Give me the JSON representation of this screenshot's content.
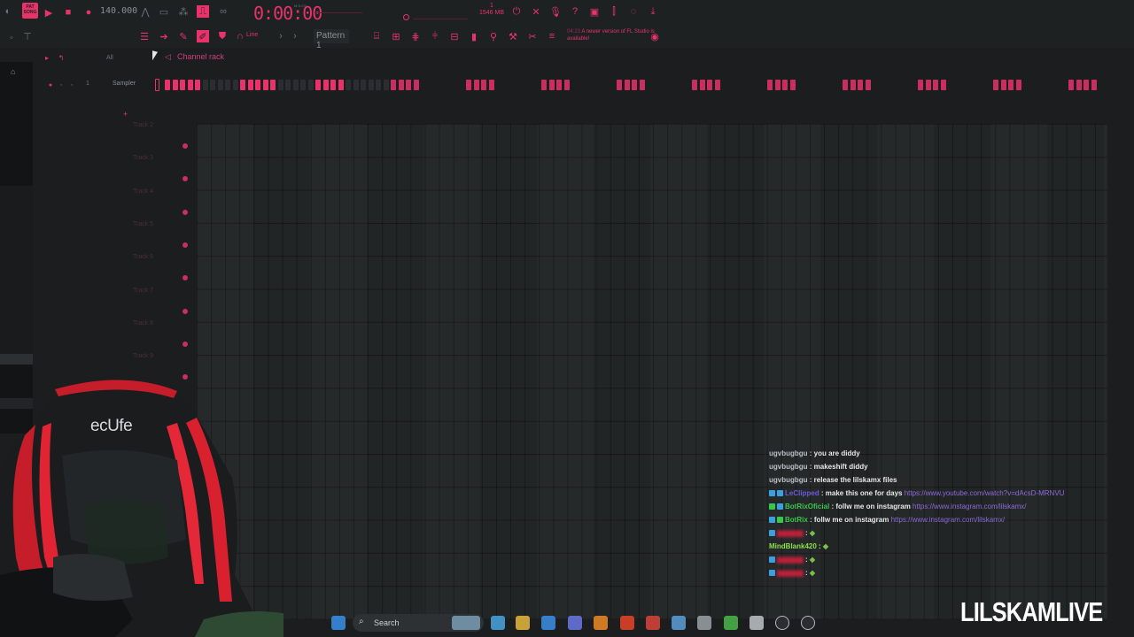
{
  "toolbar": {
    "menu_badge": "PAT SONG",
    "bpm": "140.000",
    "song_time": "0:00:00",
    "time_label": "M:S:CS",
    "cpu_ram": "1546 MB",
    "cpu_count": "1",
    "pattern": "Pattern 1",
    "snap": "Line",
    "news_time": "04:23",
    "news_text": "A newer version of FL Studio is available!"
  },
  "channel_rack": {
    "filter": "All",
    "title": "Channel rack",
    "channel_number": "1",
    "channel_name": "Sampler",
    "steps": [
      1,
      1,
      1,
      1,
      1,
      0,
      0,
      0,
      0,
      0,
      1,
      1,
      1,
      1,
      1,
      0,
      0,
      0,
      0,
      0,
      1,
      1,
      1,
      1,
      0,
      0,
      0,
      0,
      0,
      0,
      1,
      1,
      1,
      1,
      0,
      0,
      0,
      0,
      0,
      0,
      1,
      1,
      1,
      1,
      0,
      0,
      0,
      0,
      0,
      0,
      1,
      1,
      1,
      1,
      0,
      0,
      0,
      0,
      0,
      0,
      1,
      1,
      1,
      1,
      0,
      0,
      0,
      0,
      0,
      0,
      1,
      1,
      1,
      1,
      0,
      0,
      0,
      0,
      0,
      0,
      1,
      1,
      1,
      1,
      0,
      0,
      0,
      0,
      0,
      0,
      1,
      1,
      1,
      1,
      0,
      0,
      0,
      0,
      0,
      0,
      1,
      1,
      1,
      1,
      0,
      0,
      0,
      0,
      0,
      0,
      1,
      1,
      1,
      1,
      0,
      0,
      0,
      0,
      0,
      0,
      1,
      1,
      1,
      1,
      0,
      0,
      0,
      0,
      0,
      0,
      1,
      1,
      1,
      1,
      0,
      0,
      0,
      0
    ]
  },
  "playlist": {
    "tracks": [
      "Track 2",
      "Track 3",
      "Track 4",
      "Track 5",
      "Track 6",
      "Track 7",
      "Track 8",
      "Track 9"
    ]
  },
  "webcam": {
    "chair_brand": "ecUfe"
  },
  "chat": [
    {
      "user": "ugvbugbgu",
      "message": "you are diddy",
      "link": "",
      "user_color": "#b9c0c4",
      "badges": []
    },
    {
      "user": "ugvbugbgu",
      "message": "makeshift diddy",
      "link": "",
      "user_color": "#b9c0c4",
      "badges": []
    },
    {
      "user": "ugvbugbgu",
      "message": "release the lilskamx files",
      "link": "",
      "user_color": "#b9c0c4",
      "badges": []
    },
    {
      "user": "LeClipped",
      "message": "make this one for days",
      "link": "https://www.youtube.com/watch?v=dAcsD-MRNVU",
      "user_color": "#6a5ad8",
      "badges": [
        "#3aa0e0",
        "#3aa0e0"
      ]
    },
    {
      "user": "BotRixOficial",
      "message": "follw me on instagram",
      "link": "https://www.instagram.com/lilskamx/",
      "user_color": "#37c84a",
      "badges": [
        "#37c84a",
        "#3aa0e0"
      ]
    },
    {
      "user": "BotRix",
      "message": "follw me on instagram",
      "link": "https://www.instagram.com/lilskamx/",
      "user_color": "#37c84a",
      "badges": [
        "#3aa0e0",
        "#37c84a"
      ]
    },
    {
      "user": "",
      "message": "",
      "link": "",
      "user_color": "#c0203a",
      "badges": [
        "#3aa0e0"
      ]
    },
    {
      "user": "MindBlank420",
      "message": "",
      "link": "",
      "user_color": "#8ee04a",
      "badges": []
    },
    {
      "user": "",
      "message": "",
      "link": "",
      "user_color": "#c0203a",
      "badges": [
        "#3aa0e0"
      ]
    },
    {
      "user": "",
      "message": "",
      "link": "",
      "user_color": "#c0203a",
      "badges": [
        "#3aa0e0"
      ]
    }
  ],
  "taskbar": {
    "search_label": "Search",
    "icons": [
      "windows-start-icon",
      "search-icon",
      "car-widget-icon",
      "copilot-icon",
      "file-explorer-icon",
      "store-icon",
      "discord-icon",
      "fl-studio-icon",
      "brave-icon",
      "chrome-icon",
      "steam-icon",
      "media-icon",
      "green-app-icon",
      "4k-video-icon",
      "capture-icon",
      "play-icon"
    ]
  },
  "watermark": "LILSKAMLIVE",
  "colors": {
    "accent": "#e8336a",
    "background": "#1b1d1e",
    "grid": "#222526",
    "link": "#8e6ad8"
  }
}
